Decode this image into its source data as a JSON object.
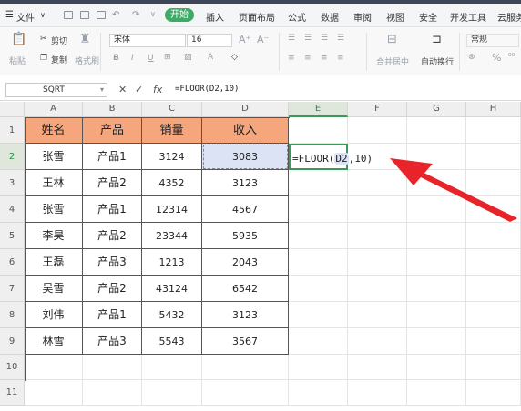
{
  "menubar": {
    "file_label": "文件",
    "items": [
      "开始",
      "插入",
      "页面布局",
      "公式",
      "数据",
      "审阅",
      "视图",
      "安全",
      "开发工具",
      "云服务"
    ]
  },
  "ribbon": {
    "paste": "粘贴",
    "cut": "剪切",
    "copy": "复制",
    "format_painter": "格式刷",
    "font_name": "宋体",
    "font_size": "16",
    "merge_center": "合并居中",
    "wrap_text": "自动换行",
    "number_format": "常规",
    "percent": "%"
  },
  "formula_bar": {
    "name_box": "SQRT",
    "cancel": "✕",
    "confirm": "✓",
    "fx": "fx",
    "formula": "=FLOOR(D2,10)"
  },
  "columns": [
    "A",
    "B",
    "C",
    "D",
    "E",
    "F",
    "G",
    "H"
  ],
  "rows": [
    "1",
    "2",
    "3",
    "4",
    "5",
    "6",
    "7",
    "8",
    "9",
    "10",
    "11"
  ],
  "table": {
    "headers": [
      "姓名",
      "产品",
      "销量",
      "收入"
    ],
    "rows": [
      [
        "张雪",
        "产品1",
        "3124",
        "3083"
      ],
      [
        "王林",
        "产品2",
        "4352",
        "3123"
      ],
      [
        "张雪",
        "产品1",
        "12314",
        "4567"
      ],
      [
        "李昊",
        "产品2",
        "23344",
        "5935"
      ],
      [
        "王磊",
        "产品3",
        "1213",
        "2043"
      ],
      [
        "吴雪",
        "产品2",
        "43124",
        "6542"
      ],
      [
        "刘伟",
        "产品1",
        "5432",
        "3123"
      ],
      [
        "林雪",
        "产品3",
        "5543",
        "3567"
      ]
    ]
  },
  "active_cell": {
    "text_before": "=FLOOR(",
    "ref": "D2",
    "text_after": ",10)"
  },
  "colors": {
    "header_fill": "#f5a67d",
    "accent_green": "#3daa68",
    "arrow_red": "#e8242a",
    "ref_highlight": "#dbe3f5"
  }
}
